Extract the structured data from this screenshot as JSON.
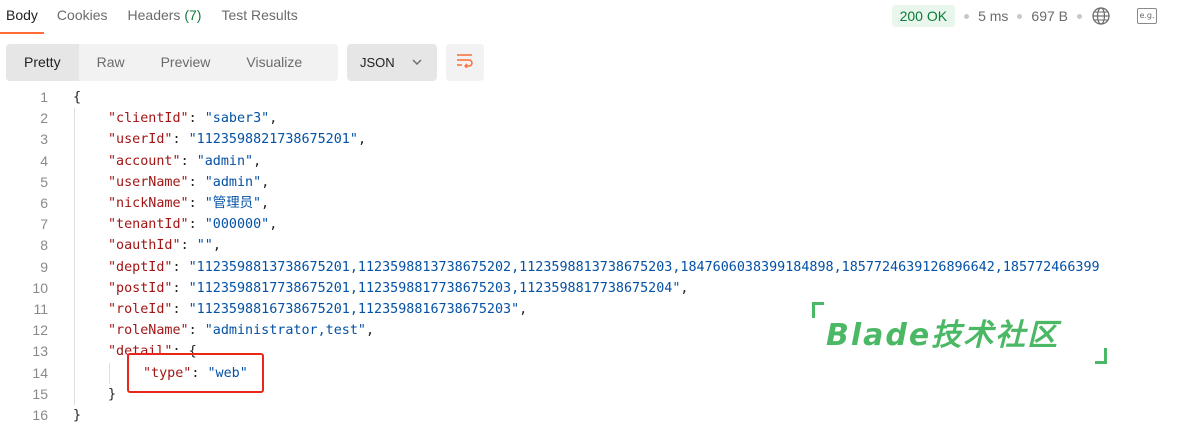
{
  "tabs": [
    {
      "label": "Body",
      "active": true
    },
    {
      "label": "Cookies"
    },
    {
      "label": "Headers",
      "count": "(7)"
    },
    {
      "label": "Test Results"
    }
  ],
  "status": {
    "code": "200 OK",
    "time": "5 ms",
    "size": "697 B",
    "eg_label": "e.g."
  },
  "modes": [
    "Pretty",
    "Raw",
    "Preview",
    "Visualize"
  ],
  "format": "JSON",
  "code_lines": [
    {
      "n": "1",
      "indent": 0,
      "parts": [
        [
          "punc",
          "{"
        ]
      ]
    },
    {
      "n": "2",
      "indent": 1,
      "parts": [
        [
          "key",
          "\"clientId\""
        ],
        [
          "punc",
          ": "
        ],
        [
          "str",
          "\"saber3\""
        ],
        [
          "punc",
          ","
        ]
      ]
    },
    {
      "n": "3",
      "indent": 1,
      "parts": [
        [
          "key",
          "\"userId\""
        ],
        [
          "punc",
          ": "
        ],
        [
          "str",
          "\"1123598821738675201\""
        ],
        [
          "punc",
          ","
        ]
      ]
    },
    {
      "n": "4",
      "indent": 1,
      "parts": [
        [
          "key",
          "\"account\""
        ],
        [
          "punc",
          ": "
        ],
        [
          "str",
          "\"admin\""
        ],
        [
          "punc",
          ","
        ]
      ]
    },
    {
      "n": "5",
      "indent": 1,
      "parts": [
        [
          "key",
          "\"userName\""
        ],
        [
          "punc",
          ": "
        ],
        [
          "str",
          "\"admin\""
        ],
        [
          "punc",
          ","
        ]
      ]
    },
    {
      "n": "6",
      "indent": 1,
      "parts": [
        [
          "key",
          "\"nickName\""
        ],
        [
          "punc",
          ": "
        ],
        [
          "str",
          "\"管理员\""
        ],
        [
          "punc",
          ","
        ]
      ]
    },
    {
      "n": "7",
      "indent": 1,
      "parts": [
        [
          "key",
          "\"tenantId\""
        ],
        [
          "punc",
          ": "
        ],
        [
          "str",
          "\"000000\""
        ],
        [
          "punc",
          ","
        ]
      ]
    },
    {
      "n": "8",
      "indent": 1,
      "parts": [
        [
          "key",
          "\"oauthId\""
        ],
        [
          "punc",
          ": "
        ],
        [
          "str",
          "\"\""
        ],
        [
          "punc",
          ","
        ]
      ]
    },
    {
      "n": "9",
      "indent": 1,
      "parts": [
        [
          "key",
          "\"deptId\""
        ],
        [
          "punc",
          ": "
        ],
        [
          "str",
          "\"1123598813738675201,1123598813738675202,1123598813738675203,1847606038399184898,1857724639126896642,185772466399"
        ]
      ]
    },
    {
      "n": "10",
      "indent": 1,
      "parts": [
        [
          "key",
          "\"postId\""
        ],
        [
          "punc",
          ": "
        ],
        [
          "str",
          "\"1123598817738675201,1123598817738675203,1123598817738675204\""
        ],
        [
          "punc",
          ","
        ]
      ]
    },
    {
      "n": "11",
      "indent": 1,
      "parts": [
        [
          "key",
          "\"roleId\""
        ],
        [
          "punc",
          ": "
        ],
        [
          "str",
          "\"1123598816738675201,1123598816738675203\""
        ],
        [
          "punc",
          ","
        ]
      ]
    },
    {
      "n": "12",
      "indent": 1,
      "parts": [
        [
          "key",
          "\"roleName\""
        ],
        [
          "punc",
          ": "
        ],
        [
          "str",
          "\"administrator,test\""
        ],
        [
          "punc",
          ","
        ]
      ]
    },
    {
      "n": "13",
      "indent": 1,
      "parts": [
        [
          "key",
          "\"detail\""
        ],
        [
          "punc",
          ": {"
        ]
      ]
    },
    {
      "n": "14",
      "indent": 2,
      "parts": [
        [
          "key",
          "\"type\""
        ],
        [
          "punc",
          ": "
        ],
        [
          "str",
          "\"web\""
        ]
      ]
    },
    {
      "n": "15",
      "indent": 1,
      "parts": [
        [
          "punc",
          "}"
        ]
      ]
    },
    {
      "n": "16",
      "indent": 0,
      "parts": [
        [
          "punc",
          "}"
        ]
      ]
    }
  ],
  "watermark": "Blade技术社区",
  "colors": {
    "accent": "#ff6c37",
    "status_ok": "#0a7c39",
    "json_key": "#a31515",
    "json_string": "#0451a5",
    "highlight": "#e8261a",
    "watermark": "#4bb866"
  }
}
